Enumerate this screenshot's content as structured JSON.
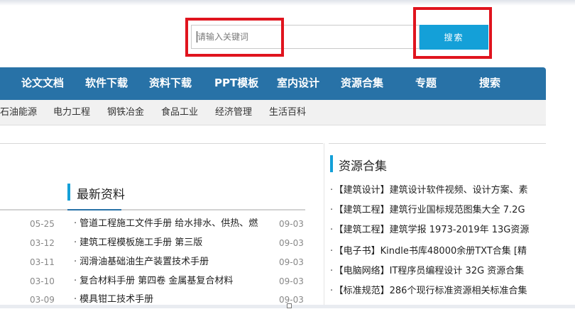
{
  "search": {
    "placeholder": "请输入关键词",
    "button_label": "搜索"
  },
  "main_nav": [
    {
      "label": "论文文档"
    },
    {
      "label": "软件下载"
    },
    {
      "label": "资料下载"
    },
    {
      "label": "PPT模板"
    },
    {
      "label": "室内设计"
    },
    {
      "label": "资源合集"
    },
    {
      "label": "专题"
    },
    {
      "label": "搜索"
    }
  ],
  "sub_nav": [
    {
      "label": "石油能源"
    },
    {
      "label": "电力工程"
    },
    {
      "label": "钢铁冶金"
    },
    {
      "label": "食品工业"
    },
    {
      "label": "经济管理"
    },
    {
      "label": "生活百科"
    }
  ],
  "latest": {
    "title": "最新资料",
    "items": [
      {
        "left_date": "05-25",
        "title": "管道工程施工文件手册 给水排水、供热、燃",
        "right_date": "09-03"
      },
      {
        "left_date": "03-12",
        "title": "建筑工程模板施工手册 第三版",
        "right_date": "09-03"
      },
      {
        "left_date": "03-11",
        "title": "润滑油基础油生产装置技术手册",
        "right_date": "09-03"
      },
      {
        "left_date": "03-10",
        "title": "复合材料手册 第四卷 金属基复合材料",
        "right_date": "09-03"
      },
      {
        "left_date": "03-09",
        "title": "模具钳工技术手册",
        "right_date": "09-03"
      }
    ]
  },
  "resources": {
    "title": "资源合集",
    "items": [
      {
        "text": "【建筑设计】建筑设计软件视频、设计方案、素"
      },
      {
        "text": "【建筑工程】建筑行业国标规范图集大全 7.2G"
      },
      {
        "text": "【建筑工程】建筑学报 1973-2019年 13G资源"
      },
      {
        "text": "【电子书】Kindle书库48000余册TXT合集 [精"
      },
      {
        "text": "【电脑网络】IT程序员编程设计 32G 资源合集"
      },
      {
        "text": "【标准规范】286个现行标准资源相关标准合集"
      }
    ]
  },
  "colors": {
    "nav_bg": "#2872a7",
    "search_button": "#14a0d8",
    "highlight": "#e0141e"
  }
}
